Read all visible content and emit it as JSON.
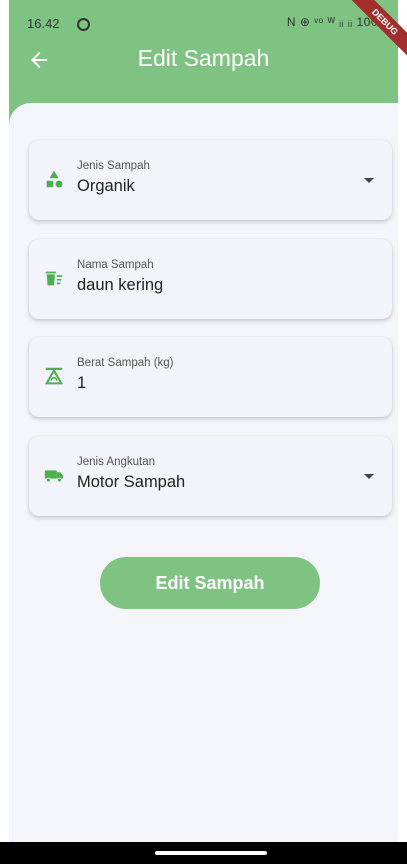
{
  "status_bar": {
    "time": "16.42",
    "right_indicators": "N ⊕ ᵛᵒ ᵂ ᵢᵢ ᵢᵢ 100"
  },
  "debug_banner": "DEBUG",
  "app_bar": {
    "title": "Edit Sampah",
    "back_icon": "arrow-left-icon"
  },
  "form": {
    "jenis_sampah": {
      "label": "Jenis Sampah",
      "value": "Organik",
      "icon": "category-icon"
    },
    "nama_sampah": {
      "label": "Nama Sampah",
      "value": "daun kering",
      "icon": "trash-list-icon"
    },
    "berat_sampah": {
      "label": "Berat Sampah (kg)",
      "value": "1",
      "icon": "scale-icon"
    },
    "jenis_angkutan": {
      "label": "Jenis Angkutan",
      "value": "Motor Sampah",
      "icon": "truck-icon"
    }
  },
  "submit_label": "Edit Sampah",
  "colors": {
    "primary": "#7fc382",
    "icon": "#4caf50",
    "background": "#f4f5fa"
  }
}
